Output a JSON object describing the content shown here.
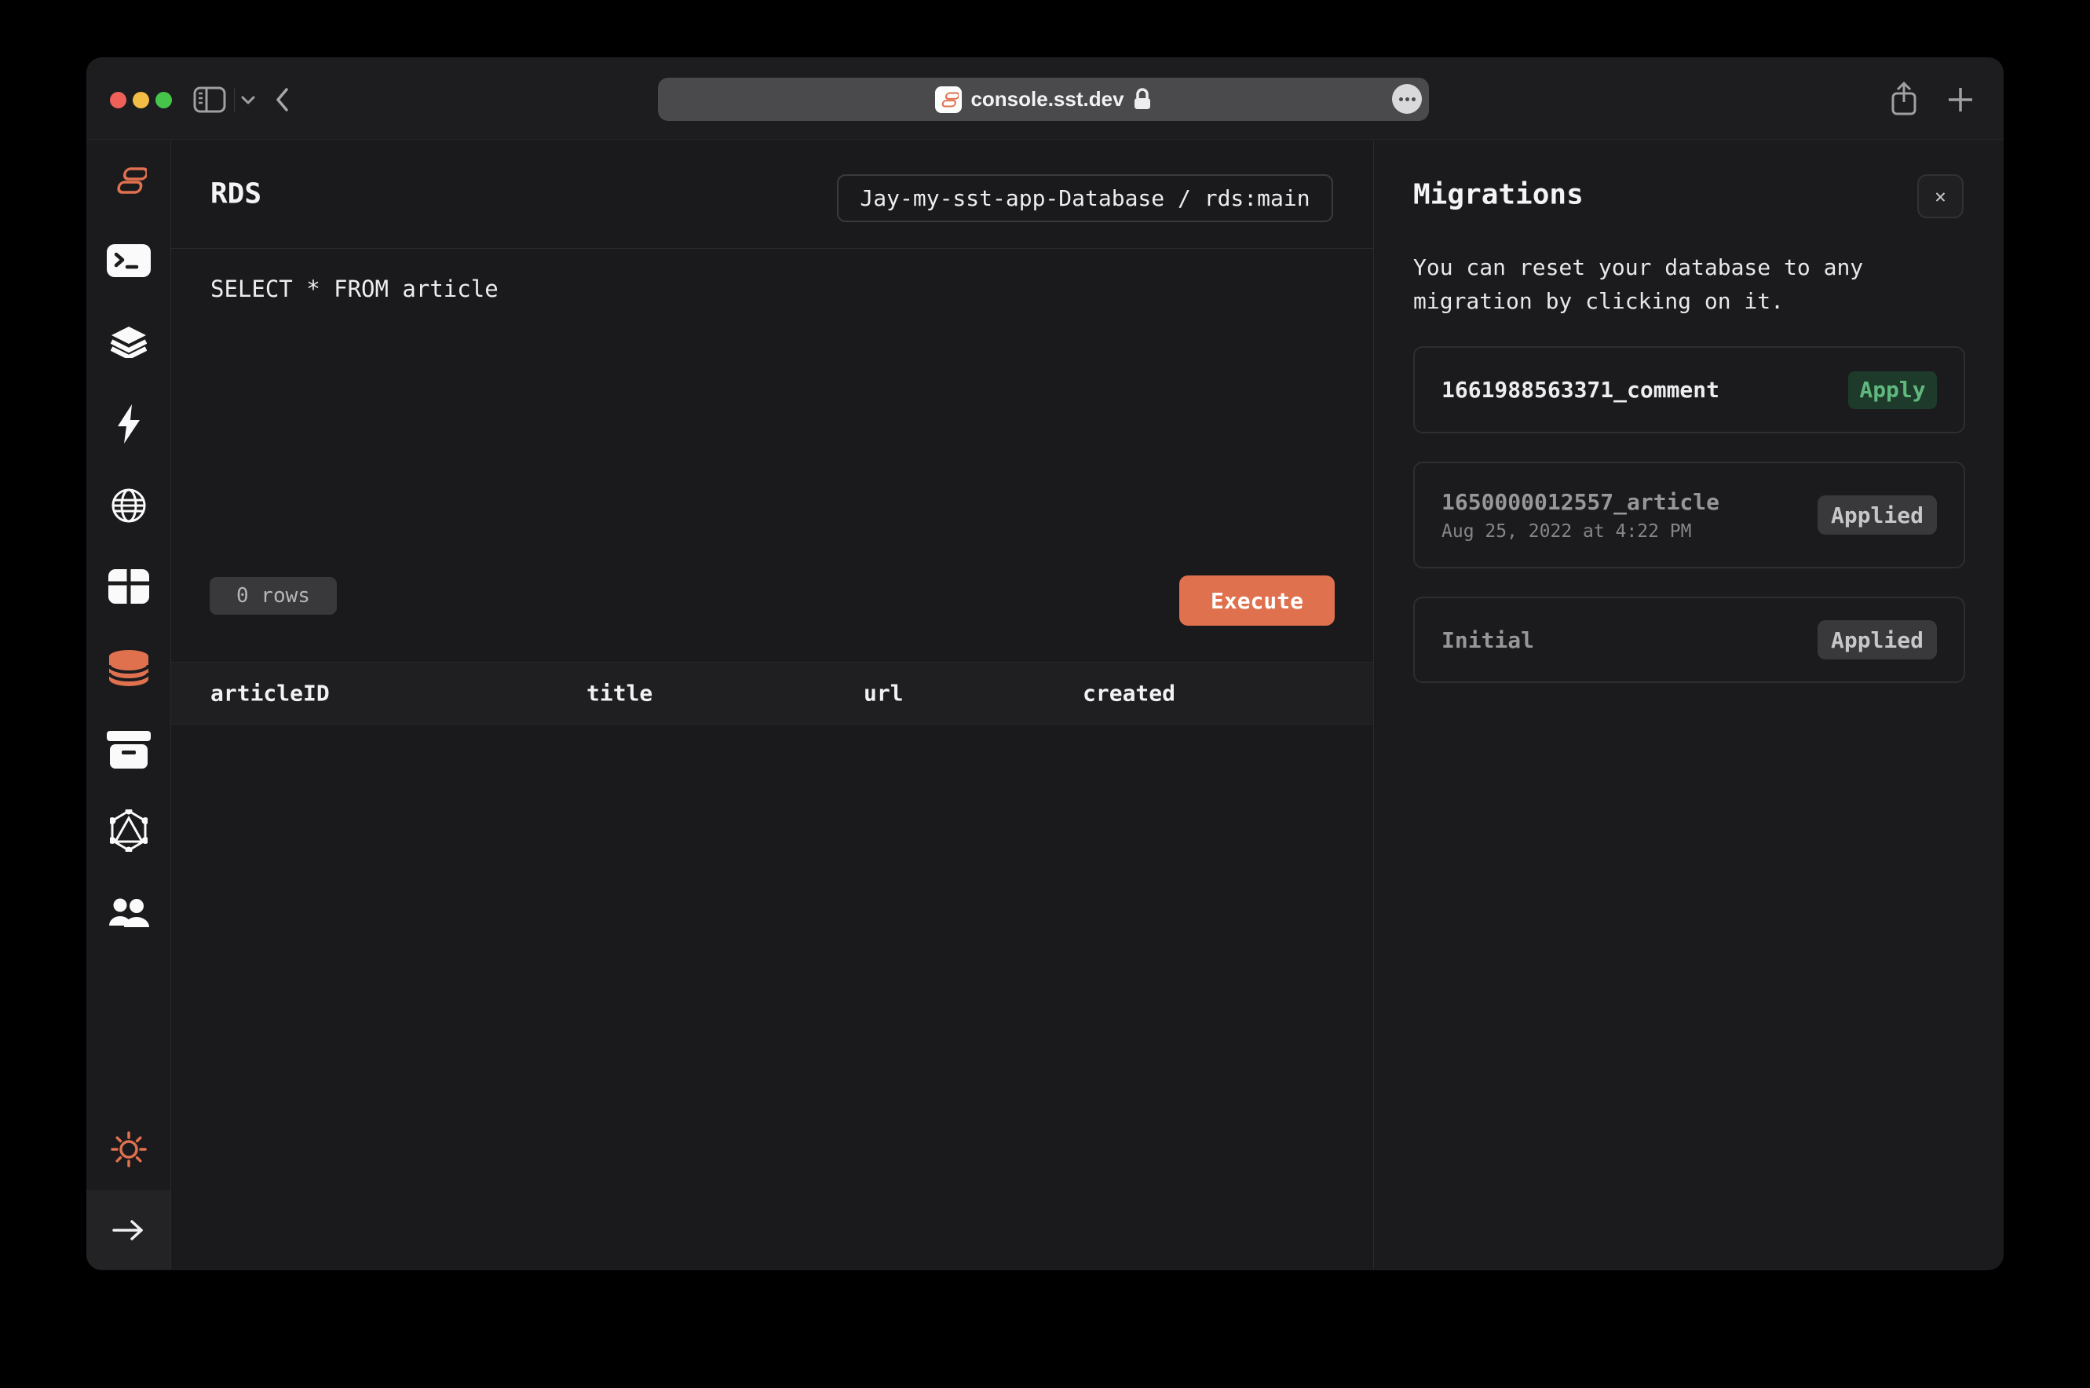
{
  "browser_toolbar": {
    "url_text": "console.sst.dev",
    "icons": [
      "sidebar-toggle",
      "chevron-down",
      "back",
      "site-favicon-sst",
      "lock",
      "page-menu-ellipsis",
      "share",
      "new-tab-plus"
    ],
    "traffic_lights": [
      "close",
      "minimize",
      "zoom"
    ]
  },
  "sidebar": {
    "items": [
      {
        "id": "sst-home",
        "icon": "sst-logo-icon",
        "active": false
      },
      {
        "id": "local",
        "icon": "terminal-icon",
        "active": false
      },
      {
        "id": "stacks",
        "icon": "layers-icon",
        "active": false
      },
      {
        "id": "functions",
        "icon": "lightning-icon",
        "active": false
      },
      {
        "id": "api",
        "icon": "globe-icon",
        "active": false
      },
      {
        "id": "dynamodb",
        "icon": "table-icon",
        "active": false
      },
      {
        "id": "rds",
        "icon": "database-icon",
        "active": true
      },
      {
        "id": "buckets",
        "icon": "archive-icon",
        "active": false
      },
      {
        "id": "graphql",
        "icon": "graphql-icon",
        "active": false
      },
      {
        "id": "cognito",
        "icon": "users-icon",
        "active": false
      }
    ],
    "theme_toggle_icon": "sun-icon",
    "collapse_icon": "arrow-right-icon"
  },
  "main": {
    "title": "RDS",
    "database_selector": "Jay-my-sst-app-Database / rds:main",
    "editor": {
      "query": "SELECT * FROM article"
    },
    "status": {
      "row_count": "0 rows"
    },
    "execute_label": "Execute",
    "results": {
      "columns": [
        "articleID",
        "title",
        "url",
        "created"
      ],
      "rows": []
    }
  },
  "migrations": {
    "title": "Migrations",
    "close_label": "✕",
    "description_line1": "You can reset your database to any",
    "description_line2": "migration by clicking on it.",
    "items": [
      {
        "name": "1661988563371_comment",
        "state": "pending",
        "action_label": "Apply"
      },
      {
        "name": "1650000012557_article",
        "state": "applied",
        "date": "Aug 25, 2022 at 4:22 PM",
        "status_label": "Applied"
      },
      {
        "name": "Initial",
        "state": "applied",
        "status_label": "Applied"
      }
    ]
  },
  "colors": {
    "accent_orange": "#e0714f",
    "apply_green_text": "#60b87e",
    "apply_green_bg": "#1d3a2a",
    "badge_gray_bg": "#39393b",
    "window_bg": "#1c1c1e",
    "content_bg": "#1a1a1c",
    "traffic_close": "#ef6158",
    "traffic_minimize": "#f1bd44",
    "traffic_zoom": "#45c64a"
  }
}
